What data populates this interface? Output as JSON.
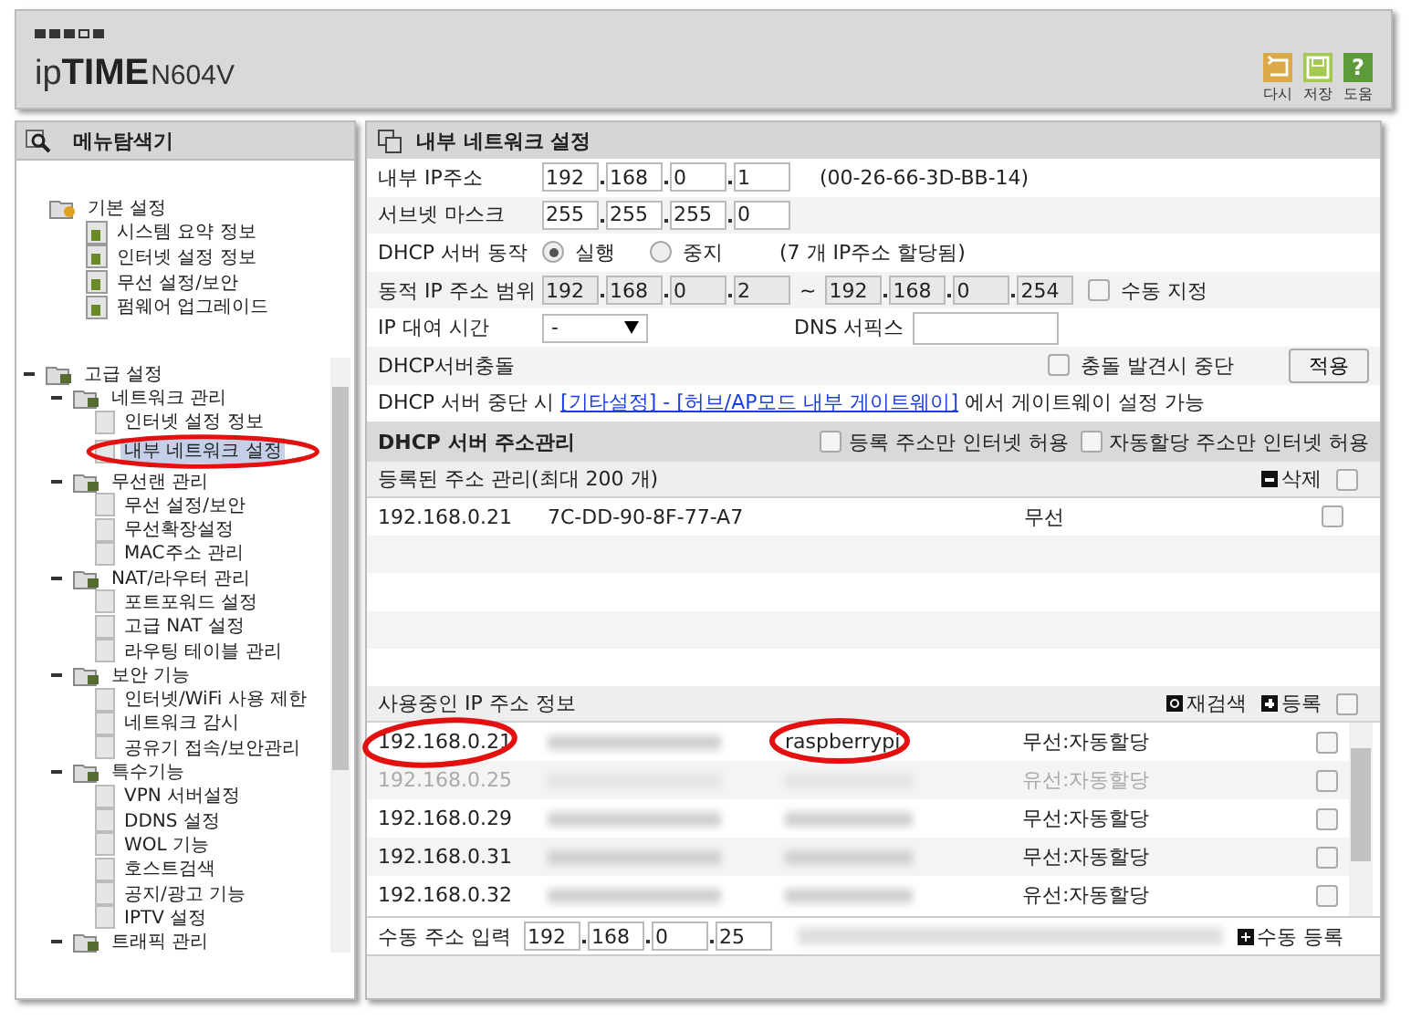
{
  "header": {
    "logo": "ip**TIME**",
    "model": "N604V",
    "tools": [
      {
        "kind": "undo",
        "label": "다시",
        "color": "#dba84a"
      },
      {
        "kind": "save",
        "label": "저장",
        "color": "#a3c94f"
      },
      {
        "kind": "help",
        "label": "도움",
        "color": "#5d9a3c",
        "glyph": "?"
      }
    ]
  },
  "nav": {
    "title": "메뉴탐색기",
    "tree": [
      {
        "label": "기본 설정",
        "children": [
          {
            "label": "시스템 요약 정보",
            "selected": false
          },
          {
            "label": "인터넷 설정 정보",
            "selected": false
          },
          {
            "label": "무선 설정/보안",
            "selected": false
          },
          {
            "label": "펌웨어 업그레이드",
            "selected": false
          }
        ]
      },
      {
        "label": "고급 설정",
        "expanded": true,
        "children": [
          {
            "label": "네트워크 관리",
            "expanded": true,
            "children": [
              {
                "label": "인터넷 설정 정보",
                "selected": false
              },
              {
                "label": "내부 네트워크 설정",
                "selected": true,
                "circled": true
              }
            ]
          },
          {
            "label": "무선랜 관리",
            "expanded": true,
            "children": [
              {
                "label": "무선 설정/보안",
                "selected": false
              },
              {
                "label": "무선확장설정",
                "selected": false
              },
              {
                "label": "MAC주소 관리",
                "selected": false
              }
            ]
          },
          {
            "label": "NAT/라우터 관리",
            "expanded": true,
            "children": [
              {
                "label": "포트포워드 설정",
                "selected": false
              },
              {
                "label": "고급 NAT 설정",
                "selected": false
              },
              {
                "label": "라우팅 테이블 관리",
                "selected": false
              }
            ]
          },
          {
            "label": "보안 기능",
            "expanded": true,
            "children": [
              {
                "label": "인터넷/WiFi 사용 제한",
                "selected": false
              },
              {
                "label": "네트워크 감시",
                "selected": false
              },
              {
                "label": "공유기 접속/보안관리",
                "selected": false
              }
            ]
          },
          {
            "label": "특수기능",
            "expanded": true,
            "children": [
              {
                "label": "VPN 서버설정",
                "selected": false
              },
              {
                "label": "DDNS 설정",
                "selected": false
              },
              {
                "label": "WOL 기능",
                "selected": false
              },
              {
                "label": "호스트검색",
                "selected": false
              },
              {
                "label": "공지/광고 기능",
                "selected": false
              },
              {
                "label": "IPTV 설정",
                "selected": false
              }
            ]
          },
          {
            "label": "트래픽 관리",
            "expanded": true
          }
        ]
      }
    ]
  },
  "panel": {
    "title": "내부 네트워크 설정",
    "form": [
      {
        "kind": "ip",
        "label": "내부 IP주소",
        "octets": [
          "192",
          "168",
          "0",
          "1"
        ],
        "note": "(00-26-66-3D-BB-14)"
      },
      {
        "kind": "ip",
        "label": "서브넷 마스크",
        "octets": [
          "255",
          "255",
          "255",
          "0"
        ]
      },
      {
        "kind": "radio",
        "label": "DHCP 서버 동작",
        "options": [
          {
            "label": "실행",
            "selected": true
          },
          {
            "label": "중지",
            "selected": false
          }
        ],
        "note": "(7 개 IP주소 할당됨)"
      },
      {
        "kind": "range",
        "label": "동적 IP 주소 범위",
        "from": [
          "192",
          "168",
          "0",
          "2"
        ],
        "separator": "~",
        "to": [
          "192",
          "168",
          "0",
          "254"
        ],
        "disabled": true,
        "checkbox": {
          "label": "수동 지정",
          "checked": false
        }
      },
      {
        "kind": "lease",
        "label": "IP 대여 시간",
        "select": "-",
        "dns_label": "DNS 서픽스"
      },
      {
        "kind": "conflict",
        "label": "DHCP서버충돌",
        "checkbox": {
          "label": "충돌 발견시 중단",
          "checked": false
        },
        "button": "적용"
      },
      {
        "kind": "note",
        "prefix": "DHCP 서버 중단 시 ",
        "link": "[기타설정] - [허브/AP모드 내부 게이트웨이]",
        "suffix": " 에서 게이트웨이 설정 가능"
      }
    ],
    "dhcp": {
      "title": "DHCP 서버 주소관리",
      "options": [
        {
          "label": "등록 주소만 인터넷 허용",
          "checked": false
        },
        {
          "label": "자동할당 주소만 인터넷 허용",
          "checked": false
        }
      ],
      "registered": {
        "title": "등록된 주소 관리(최대 200 개)",
        "delete": "삭제",
        "checked": false,
        "rows": [
          {
            "ip": "192.168.0.21",
            "mac": "7C-DD-90-8F-77-A7",
            "type": "무선",
            "checked": false
          }
        ]
      },
      "in_use": {
        "title": "사용중인 IP 주소 정보",
        "rescan": "재검색",
        "register": "등록",
        "checked": false,
        "rows": [
          {
            "ip": "192.168.0.21",
            "name": "raspberrypi",
            "type": "무선:자동할당",
            "disabled": false,
            "checked": false,
            "circled": true
          },
          {
            "ip": "192.168.0.25",
            "type": "유선:자동할당",
            "disabled": true,
            "checked": false,
            "circled": false
          },
          {
            "ip": "192.168.0.29",
            "type": "무선:자동할당",
            "disabled": false,
            "checked": false,
            "circled": false
          },
          {
            "ip": "192.168.0.31",
            "type": "무선:자동할당",
            "disabled": false,
            "checked": false,
            "circled": false
          },
          {
            "ip": "192.168.0.32",
            "type": "유선:자동할당",
            "disabled": false,
            "checked": false,
            "circled": false
          }
        ]
      },
      "manual": {
        "label": "수동 주소 입력",
        "octets": [
          "192",
          "168",
          "0",
          "25"
        ],
        "button": "수동 등록"
      }
    }
  }
}
